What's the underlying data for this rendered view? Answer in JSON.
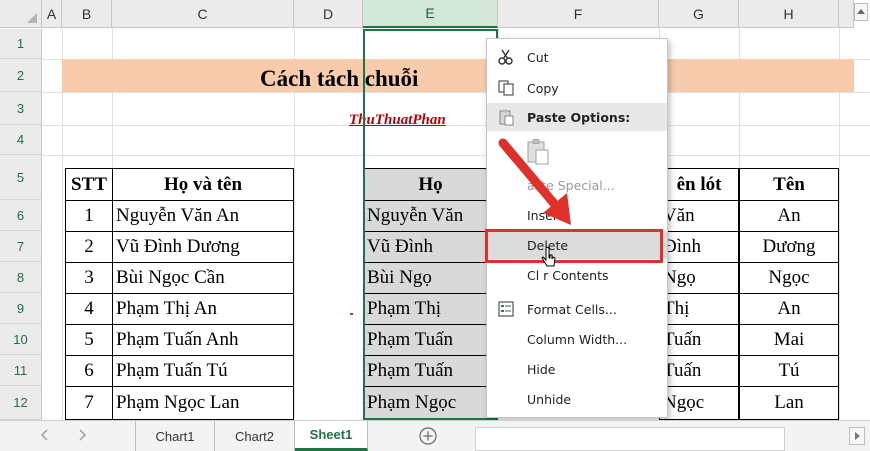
{
  "columns": [
    "A",
    "B",
    "C",
    "D",
    "E",
    "F",
    "G",
    "H"
  ],
  "rows": [
    "1",
    "2",
    "3",
    "4",
    "5",
    "6",
    "7",
    "8",
    "9",
    "10",
    "11",
    "12"
  ],
  "sheet": {
    "title": "Cách tách chuỗi",
    "subtitle": "ThuThuatPhan",
    "headers": {
      "stt": "STT",
      "hoten": "Họ và tên",
      "ho": "Họ",
      "tenlot": "ên lót",
      "ten": "Tên"
    },
    "data": [
      {
        "stt": "1",
        "hoten": "Nguyễn Văn An",
        "ho": "Nguyễn Văn",
        "tenlot": "Văn",
        "ten": "An"
      },
      {
        "stt": "2",
        "hoten": "Vũ Đình Dương",
        "ho": "Vũ Đình",
        "tenlot": "Đình",
        "ten": "Dương"
      },
      {
        "stt": "3",
        "hoten": "Bùi Ngọc Cần",
        "ho": "Bùi Ngọ",
        "tenlot": "Ngọ",
        "ten": "Ngọc"
      },
      {
        "stt": "4",
        "hoten": "Phạm Thị An",
        "ho": "Phạm Thị",
        "tenlot": "Thị",
        "ten": "An"
      },
      {
        "stt": "5",
        "hoten": "Phạm Tuấn Anh",
        "ho": "Phạm Tuấn",
        "tenlot": "Tuấn",
        "ten": "Mai"
      },
      {
        "stt": "6",
        "hoten": "Phạm Tuấn Tú",
        "ho": "Phạm Tuấn",
        "tenlot": "Tuấn",
        "ten": "Tú"
      },
      {
        "stt": "7",
        "hoten": "Phạm Ngọc Lan",
        "ho": "Phạm Ngọc",
        "tenlot": "Ngọc",
        "ten": "Lan"
      }
    ]
  },
  "context_menu": {
    "cut": "Cut",
    "copy": "Copy",
    "paste_options": "Paste Options:",
    "paste_special": "aste Special...",
    "insert": "Inser",
    "delete": "Delete",
    "clear_contents": "Cl r Contents",
    "format_cells": "Format Cells...",
    "column_width": "Column Width...",
    "hide": "Hide",
    "unhide": "Unhide"
  },
  "tabs": [
    "Chart1",
    "Chart2",
    "Sheet1"
  ],
  "active_tab": "Sheet1",
  "colors": {
    "excel_green": "#217346",
    "banner": "#f8cbad",
    "highlight_red": "#e0302a",
    "subtitle_red": "#c00000"
  }
}
